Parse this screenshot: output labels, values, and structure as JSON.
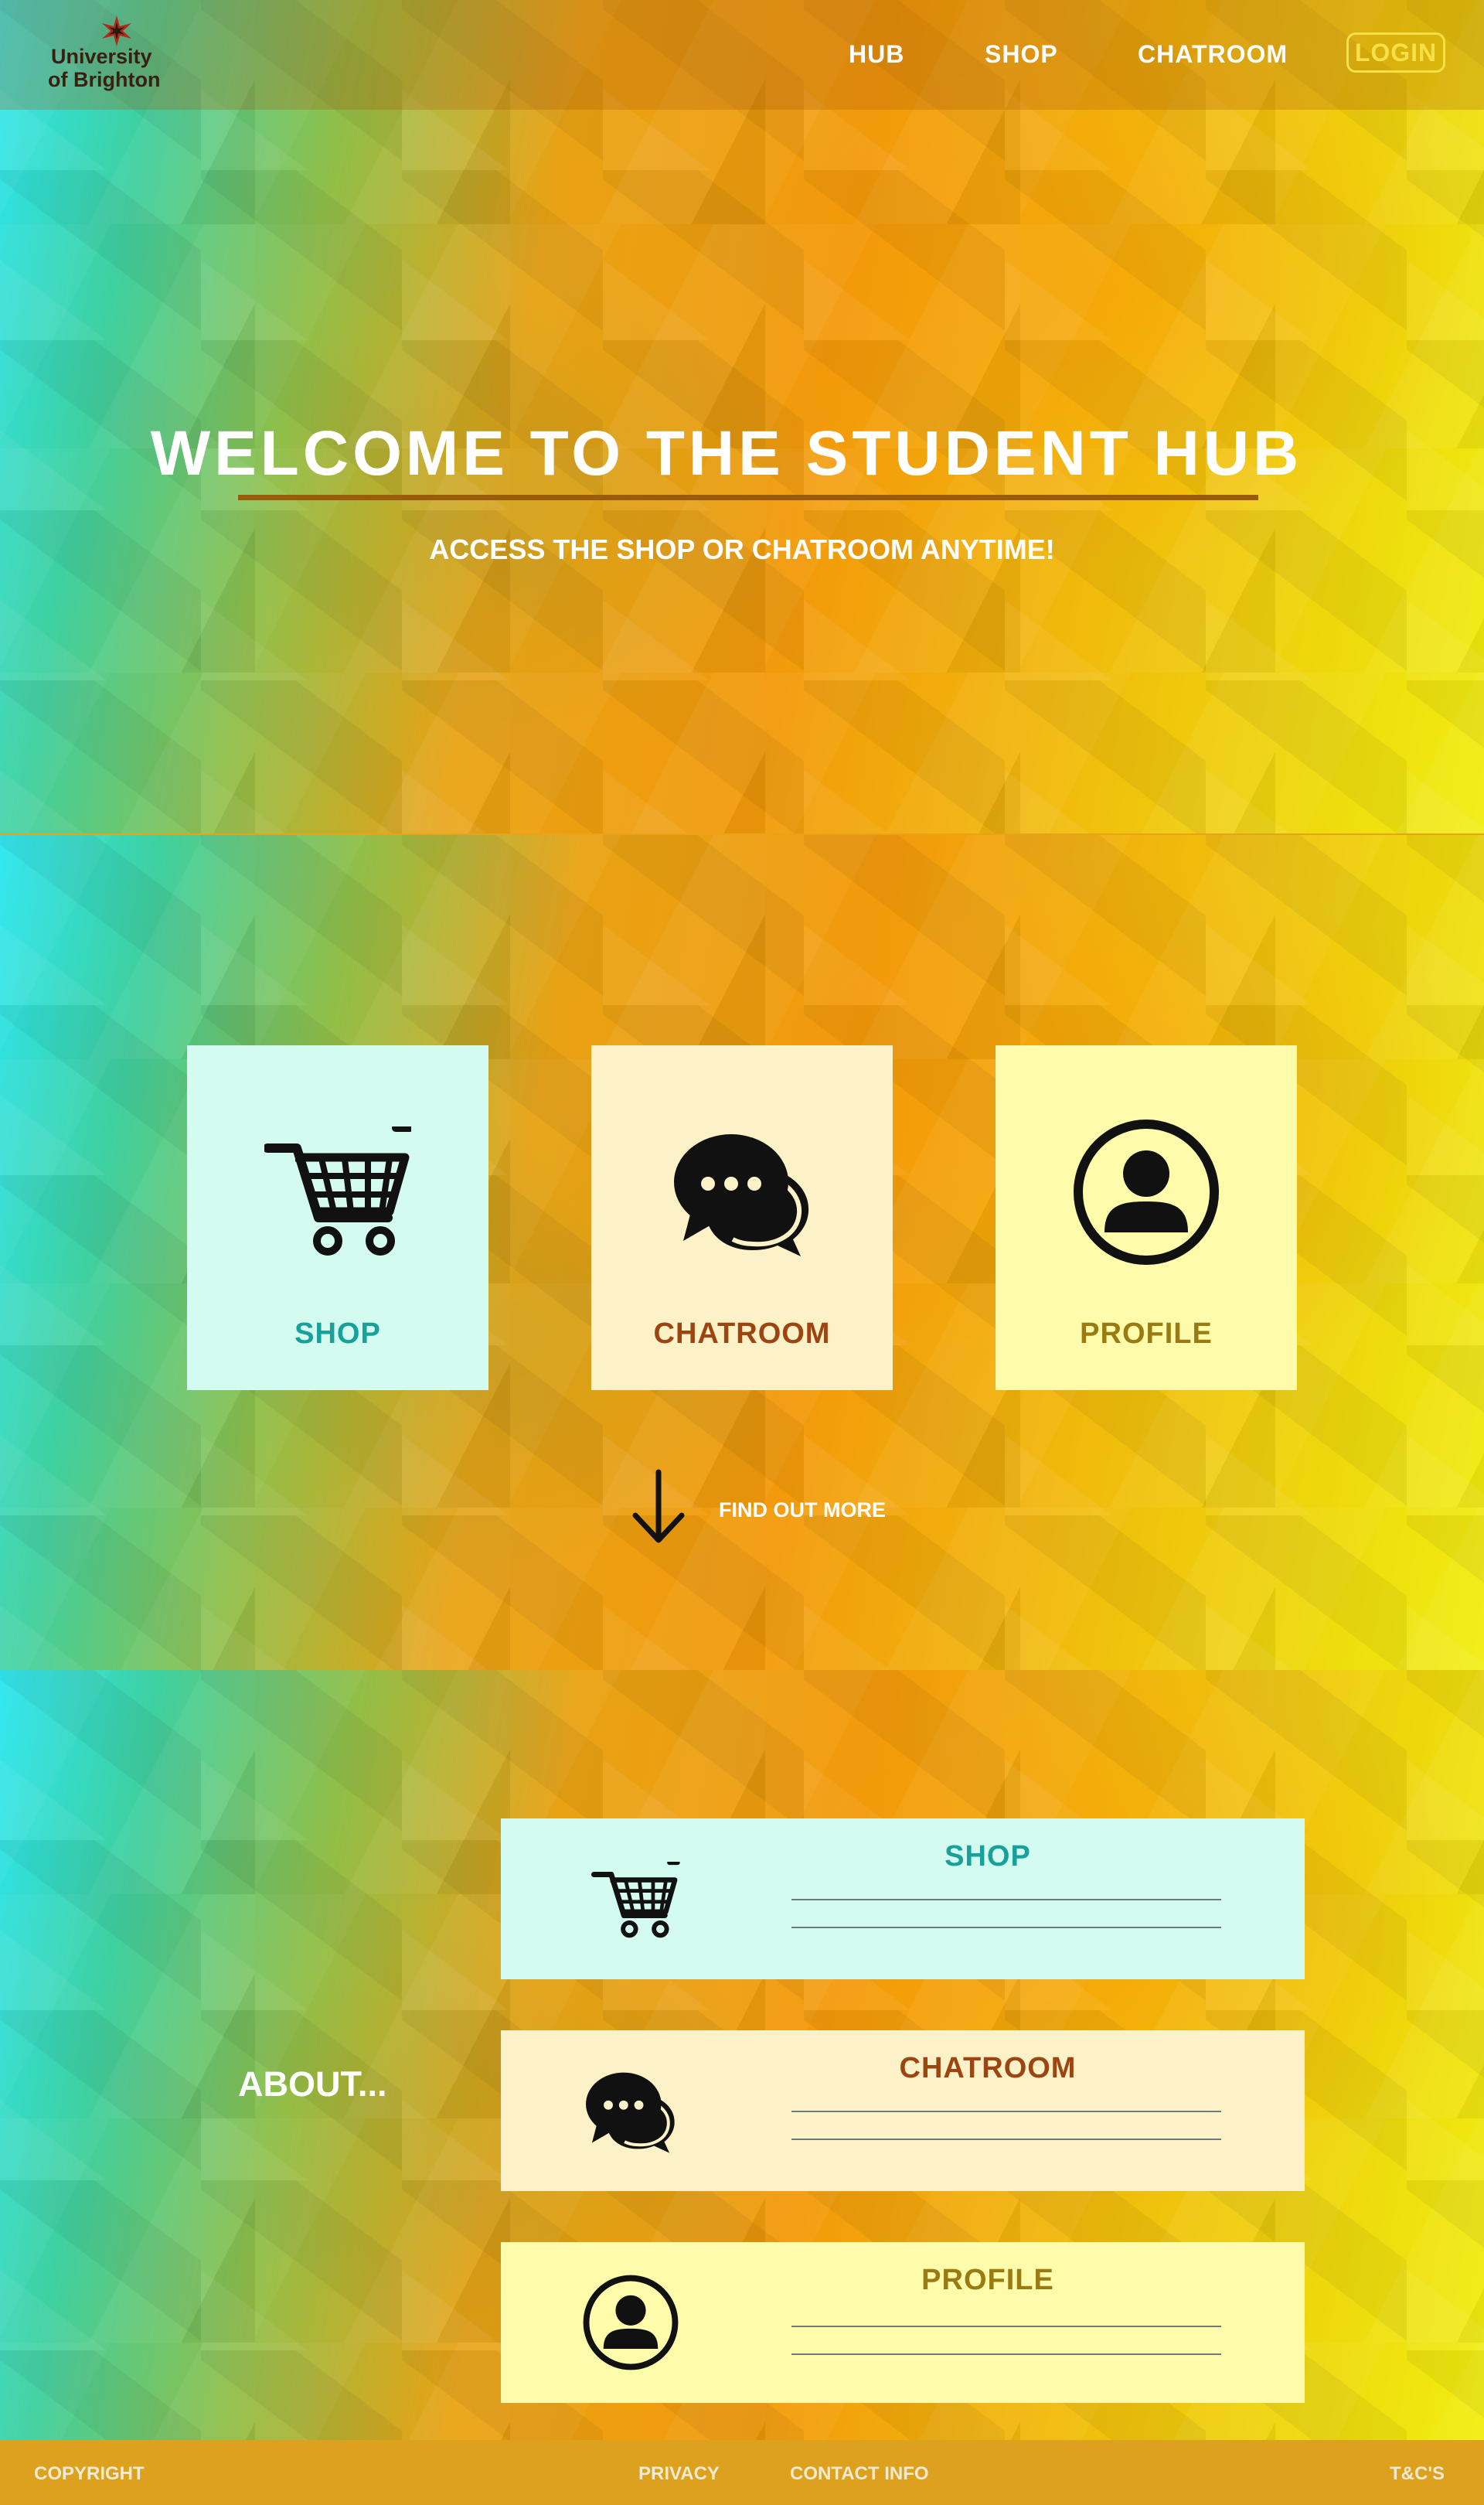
{
  "header": {
    "logo_line1": "University",
    "logo_line2": "of Brighton",
    "nav": {
      "hub": "HUB",
      "shop": "SHOP",
      "chatroom": "CHATROOM",
      "login": "LOGIN"
    }
  },
  "hero": {
    "title": "WELCOME TO THE STUDENT HUB",
    "subtitle": "ACCESS THE SHOP OR CHATROOM ANYTIME!"
  },
  "tiles": {
    "shop": {
      "label": "SHOP",
      "icon": "shopping-cart-icon"
    },
    "chatroom": {
      "label": "CHATROOM",
      "icon": "chat-bubbles-icon"
    },
    "profile": {
      "label": "PROFILE",
      "icon": "user-profile-icon"
    }
  },
  "find_more": {
    "label": "FIND OUT MORE",
    "icon": "arrow-down-icon"
  },
  "about": {
    "title": "ABOUT...",
    "cards": {
      "shop": {
        "title": "SHOP"
      },
      "chatroom": {
        "title": "CHATROOM"
      },
      "profile": {
        "title": "PROFILE"
      }
    }
  },
  "footer": {
    "copyright": "COPYRIGHT",
    "privacy": "PRIVACY",
    "contact": "CONTACT INFO",
    "terms": "T&C'S"
  },
  "colors": {
    "shop_tile": "#d3fbef",
    "chatroom_tile": "#fdf2c7",
    "profile_tile": "#fefcaa",
    "login_accent": "#f5e04a",
    "footer": "#dca11f"
  }
}
